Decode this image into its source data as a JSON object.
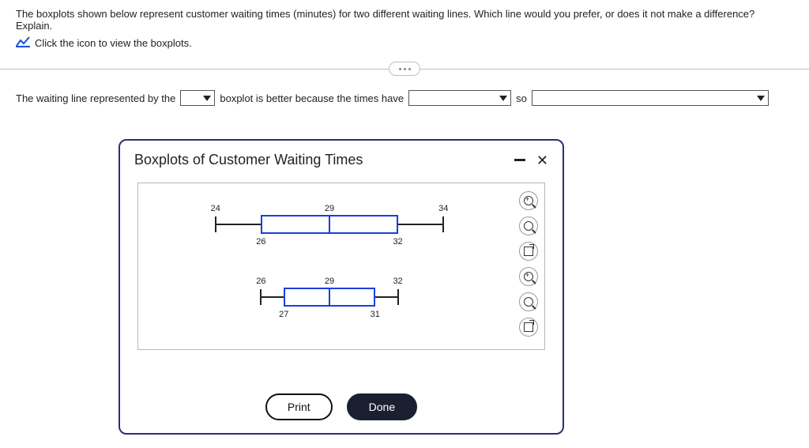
{
  "intro": "The boxplots shown below represent customer waiting times (minutes) for two different waiting lines. Which line would you prefer, or does it not make a difference? Explain.",
  "view_hint": "Click the icon to view the boxplots.",
  "sentence": {
    "p1": "The waiting line represented by the",
    "p2": "boxplot is better because the times have",
    "p3": "so"
  },
  "modal": {
    "title": "Boxplots of Customer Waiting Times",
    "print": "Print",
    "done": "Done"
  },
  "chart_data": {
    "type": "boxplot",
    "title": "Boxplots of Customer Waiting Times",
    "x_range": [
      22,
      36
    ],
    "series": [
      {
        "name": "top",
        "min": 24,
        "q1": 26,
        "median": 29,
        "q3": 32,
        "max": 34
      },
      {
        "name": "bottom",
        "min": 26,
        "q1": 27,
        "median": 29,
        "q3": 31,
        "max": 32
      }
    ],
    "labels": {
      "top": {
        "min": "24",
        "q1": "26",
        "median": "29",
        "q3": "32",
        "max": "34"
      },
      "bottom": {
        "min": "26",
        "q1": "27",
        "median": "29",
        "q3": "31",
        "max": "32"
      }
    }
  }
}
